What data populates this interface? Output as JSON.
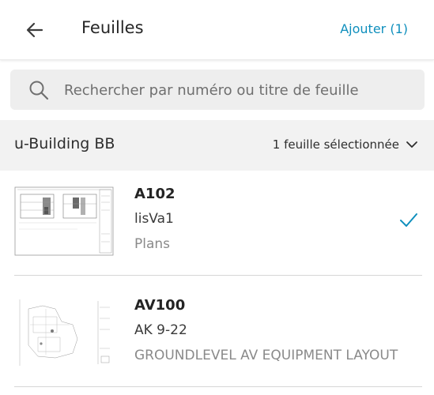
{
  "header": {
    "back_icon": "arrow-left-icon",
    "title": "Feuilles",
    "add_label": "Ajouter (1)",
    "accent_color": "#0f8fbd"
  },
  "search": {
    "icon": "search-icon",
    "placeholder": "Rechercher par numéro ou titre de feuille",
    "value": ""
  },
  "group": {
    "project_name": "u-Building BB",
    "selection_label": "1 feuille sélectionnée",
    "chevron_icon": "chevron-down-icon"
  },
  "sheets": [
    {
      "number": "A102",
      "title": "lisVa1",
      "category": "Plans",
      "selected": true,
      "check_icon": "checkmark-icon"
    },
    {
      "number": "AV100",
      "title": "AK 9-22",
      "category": "GROUNDLEVEL AV EQUIPMENT LAYOUT",
      "selected": false
    }
  ]
}
